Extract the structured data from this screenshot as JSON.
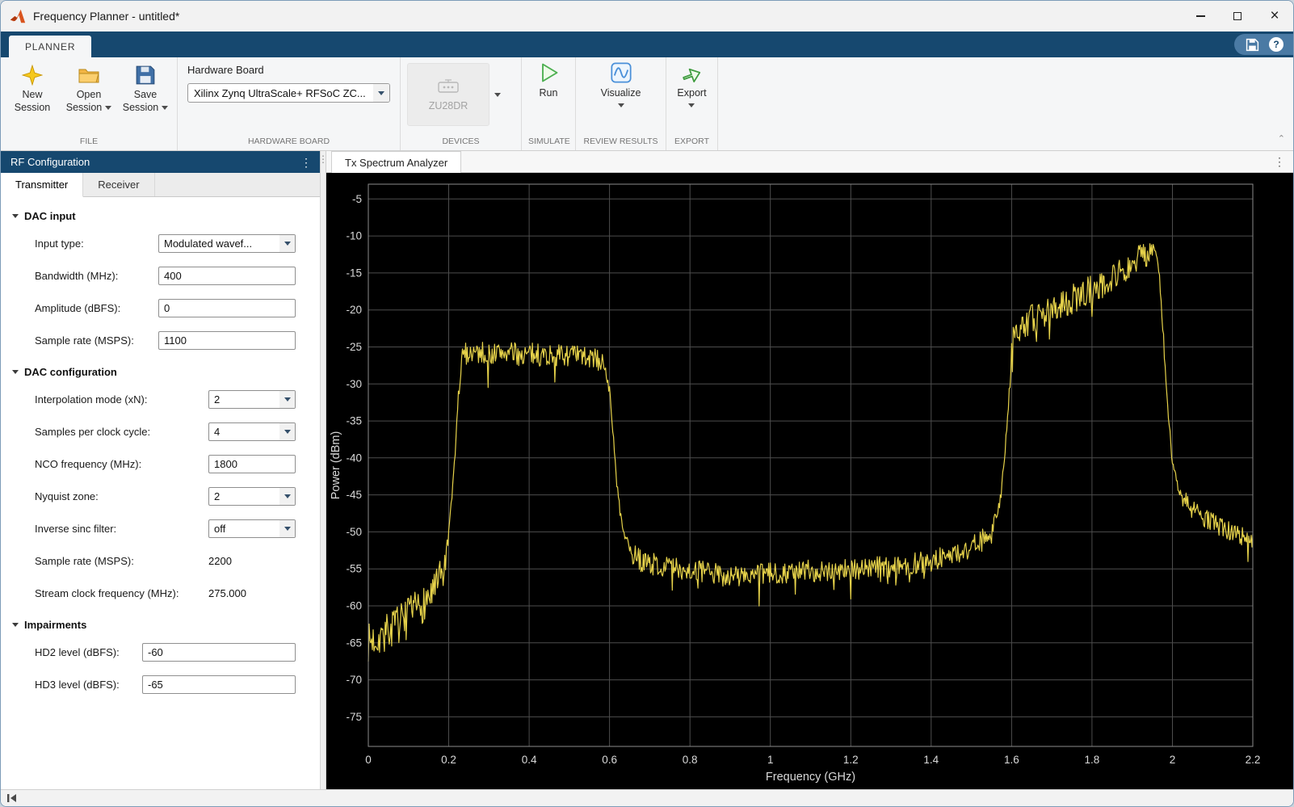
{
  "titlebar": {
    "title": "Frequency Planner - untitled*"
  },
  "icons": {
    "close": "×",
    "kebab": "⋮",
    "help": "?",
    "splitter_dots": "⋮",
    "collapse": "⌃"
  },
  "ribbon": {
    "tab_label": "PLANNER",
    "file": {
      "section_label": "FILE",
      "new1": "New",
      "new2": "Session",
      "open1": "Open",
      "open2": "Session",
      "save1": "Save",
      "save2": "Session"
    },
    "hardware": {
      "section_label": "HARDWARE BOARD",
      "field_label": "Hardware Board",
      "board_value": "Xilinx Zynq UltraScale+ RFSoC ZC..."
    },
    "devices": {
      "section_label": "DEVICES",
      "device_name": "ZU28DR"
    },
    "simulate": {
      "section_label": "SIMULATE",
      "run_label": "Run"
    },
    "review": {
      "section_label": "REVIEW RESULTS",
      "visualize_label": "Visualize"
    },
    "export": {
      "section_label": "EXPORT",
      "export_label": "Export"
    }
  },
  "rf_panel": {
    "title": "RF Configuration",
    "tabs": [
      {
        "label": "Transmitter"
      },
      {
        "label": "Receiver"
      }
    ],
    "sections": [
      {
        "title": "DAC input",
        "rows": [
          {
            "label": "Input type:",
            "type": "dropdown",
            "value": "Modulated wavef..."
          },
          {
            "label": "Bandwidth (MHz):",
            "type": "input",
            "value": "400"
          },
          {
            "label": "Amplitude (dBFS):",
            "type": "input",
            "value": "0"
          },
          {
            "label": "Sample rate (MSPS):",
            "type": "input",
            "value": "1100"
          }
        ]
      },
      {
        "title": "DAC configuration",
        "rows": [
          {
            "label": "Interpolation mode (xN):",
            "type": "dropdown",
            "value": "2"
          },
          {
            "label": "Samples per clock cycle:",
            "type": "dropdown",
            "value": "4"
          },
          {
            "label": "NCO frequency (MHz):",
            "type": "input",
            "value": "1800"
          },
          {
            "label": "Nyquist zone:",
            "type": "dropdown",
            "value": "2"
          },
          {
            "label": "Inverse sinc filter:",
            "type": "dropdown",
            "value": "off"
          },
          {
            "label": "Sample rate (MSPS):",
            "type": "static",
            "value": "2200"
          },
          {
            "label": "Stream clock frequency (MHz):",
            "type": "static",
            "value": "275.000"
          }
        ]
      },
      {
        "title": "Impairments",
        "rows": [
          {
            "label": "HD2 level (dBFS):",
            "type": "input",
            "value": "-60"
          },
          {
            "label": "HD3 level (dBFS):",
            "type": "input",
            "value": "-65"
          }
        ]
      }
    ]
  },
  "charts": {
    "tab_label": "Tx Spectrum Analyzer"
  },
  "chart_data": {
    "type": "line",
    "title": "",
    "xlabel": "Frequency (GHz)",
    "ylabel": "Power (dBm)",
    "xlim": [
      0,
      2.2
    ],
    "ylim": [
      -79,
      -3
    ],
    "xticks": [
      0,
      0.2,
      0.4,
      0.6,
      0.8,
      1,
      1.2,
      1.4,
      1.6,
      1.8,
      2,
      2.2
    ],
    "yticks": [
      -5,
      -10,
      -15,
      -20,
      -25,
      -30,
      -35,
      -40,
      -45,
      -50,
      -55,
      -60,
      -65,
      -70,
      -75
    ],
    "grid": true,
    "bg": "#000000",
    "grid_color": "#4d4d4d",
    "axis_color": "#8c8c8c",
    "tick_color": "#d9d9d9",
    "line_color": "#e6d24a",
    "series": [
      {
        "name": "Tx spectrum",
        "seed": 7,
        "step": 0.002,
        "envelope": [
          [
            0,
            -65
          ],
          [
            0.03,
            -64
          ],
          [
            0.06,
            -63
          ],
          [
            0.1,
            -61.5
          ],
          [
            0.14,
            -59.5
          ],
          [
            0.17,
            -57.5
          ],
          [
            0.19,
            -55
          ],
          [
            0.205,
            -48
          ],
          [
            0.215,
            -40
          ],
          [
            0.225,
            -31
          ],
          [
            0.235,
            -26
          ],
          [
            0.26,
            -25.6
          ],
          [
            0.3,
            -26
          ],
          [
            0.34,
            -25.7
          ],
          [
            0.38,
            -26.1
          ],
          [
            0.42,
            -25.9
          ],
          [
            0.46,
            -26.2
          ],
          [
            0.5,
            -26.1
          ],
          [
            0.54,
            -26.4
          ],
          [
            0.575,
            -26.8
          ],
          [
            0.59,
            -28
          ],
          [
            0.6,
            -31
          ],
          [
            0.608,
            -36
          ],
          [
            0.617,
            -43
          ],
          [
            0.63,
            -49
          ],
          [
            0.65,
            -52.5
          ],
          [
            0.68,
            -54
          ],
          [
            0.72,
            -54.5
          ],
          [
            0.78,
            -55
          ],
          [
            0.84,
            -55.5
          ],
          [
            0.9,
            -56
          ],
          [
            0.97,
            -55.8
          ],
          [
            1.05,
            -55.4
          ],
          [
            1.12,
            -55.2
          ],
          [
            1.2,
            -55
          ],
          [
            1.28,
            -54.8
          ],
          [
            1.36,
            -54.3
          ],
          [
            1.42,
            -53.6
          ],
          [
            1.47,
            -52.8
          ],
          [
            1.52,
            -51.5
          ],
          [
            1.55,
            -50
          ],
          [
            1.57,
            -46
          ],
          [
            1.582,
            -40
          ],
          [
            1.592,
            -33
          ],
          [
            1.6,
            -25
          ],
          [
            1.61,
            -22.5
          ],
          [
            1.65,
            -21.3
          ],
          [
            1.7,
            -20
          ],
          [
            1.75,
            -18.6
          ],
          [
            1.8,
            -17.2
          ],
          [
            1.85,
            -15.6
          ],
          [
            1.9,
            -13.8
          ],
          [
            1.93,
            -12.6
          ],
          [
            1.95,
            -11.6
          ],
          [
            1.958,
            -12
          ],
          [
            1.968,
            -16
          ],
          [
            1.978,
            -24
          ],
          [
            1.988,
            -33
          ],
          [
            2.0,
            -41
          ],
          [
            2.02,
            -45
          ],
          [
            2.05,
            -47
          ],
          [
            2.09,
            -48.5
          ],
          [
            2.14,
            -49.8
          ],
          [
            2.2,
            -51
          ]
        ],
        "noise_segments": [
          [
            0,
            0.195,
            2.6
          ],
          [
            0.195,
            0.232,
            1.2
          ],
          [
            0.232,
            0.585,
            1.5
          ],
          [
            0.585,
            0.655,
            0.7
          ],
          [
            0.655,
            1.53,
            1.5
          ],
          [
            1.53,
            1.598,
            0.8
          ],
          [
            1.598,
            1.952,
            2.0
          ],
          [
            1.952,
            2.01,
            0.8
          ],
          [
            2.01,
            2.2,
            1.3
          ]
        ]
      }
    ]
  }
}
